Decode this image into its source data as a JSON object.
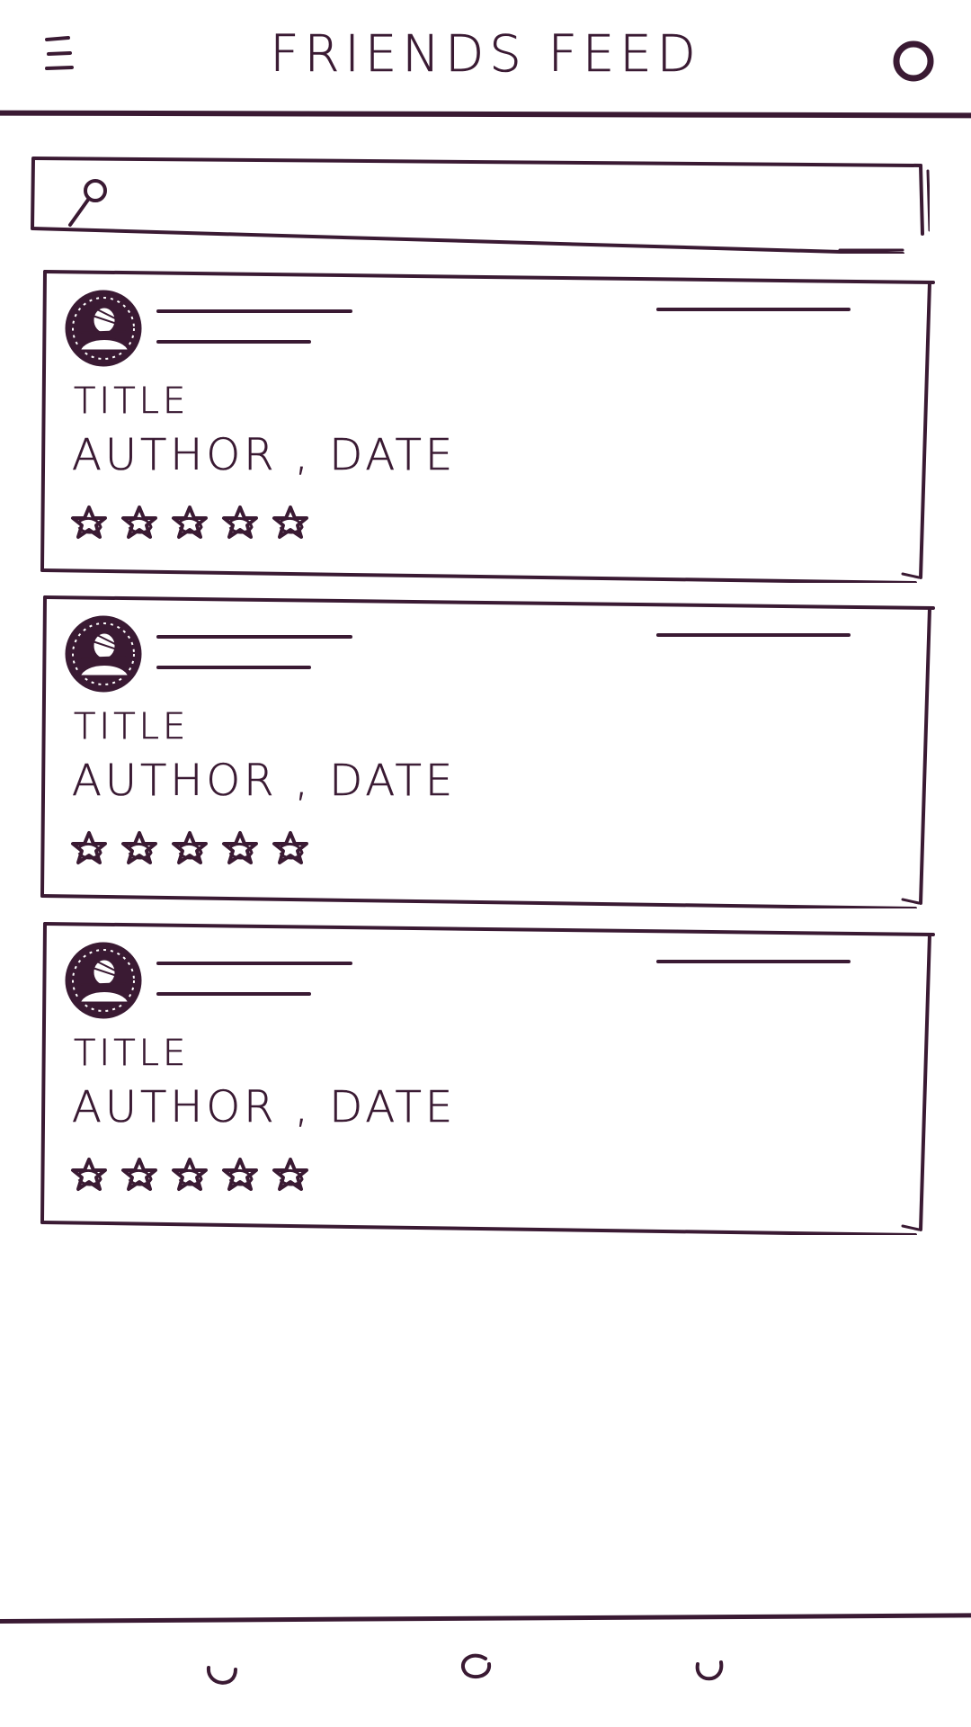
{
  "header": {
    "title": "FRIENDS FEED",
    "menu_icon": "hamburger-menu-icon",
    "profile_icon": "circle-profile-icon"
  },
  "search": {
    "icon": "search-icon",
    "value": "",
    "placeholder": ""
  },
  "feed": {
    "cards": [
      {
        "title": "TITLE",
        "meta": "AUTHOR , DATE",
        "rating_icons": [
          "star-icon",
          "star-icon",
          "star-icon",
          "star-icon",
          "star-icon"
        ]
      },
      {
        "title": "TITLE",
        "meta": "AUTHOR , DATE",
        "rating_icons": [
          "star-icon",
          "star-icon",
          "star-icon",
          "star-icon",
          "star-icon"
        ]
      },
      {
        "title": "TITLE",
        "meta": "AUTHOR , DATE",
        "rating_icons": [
          "star-icon",
          "star-icon",
          "star-icon",
          "star-icon",
          "star-icon"
        ]
      }
    ]
  },
  "bottom_nav": {
    "items": [
      {
        "icon": "nav-circle-icon"
      },
      {
        "icon": "nav-circle-icon"
      },
      {
        "icon": "nav-circle-icon"
      }
    ]
  },
  "colors": {
    "ink": "#3a1a33",
    "background": "#ffffff"
  }
}
